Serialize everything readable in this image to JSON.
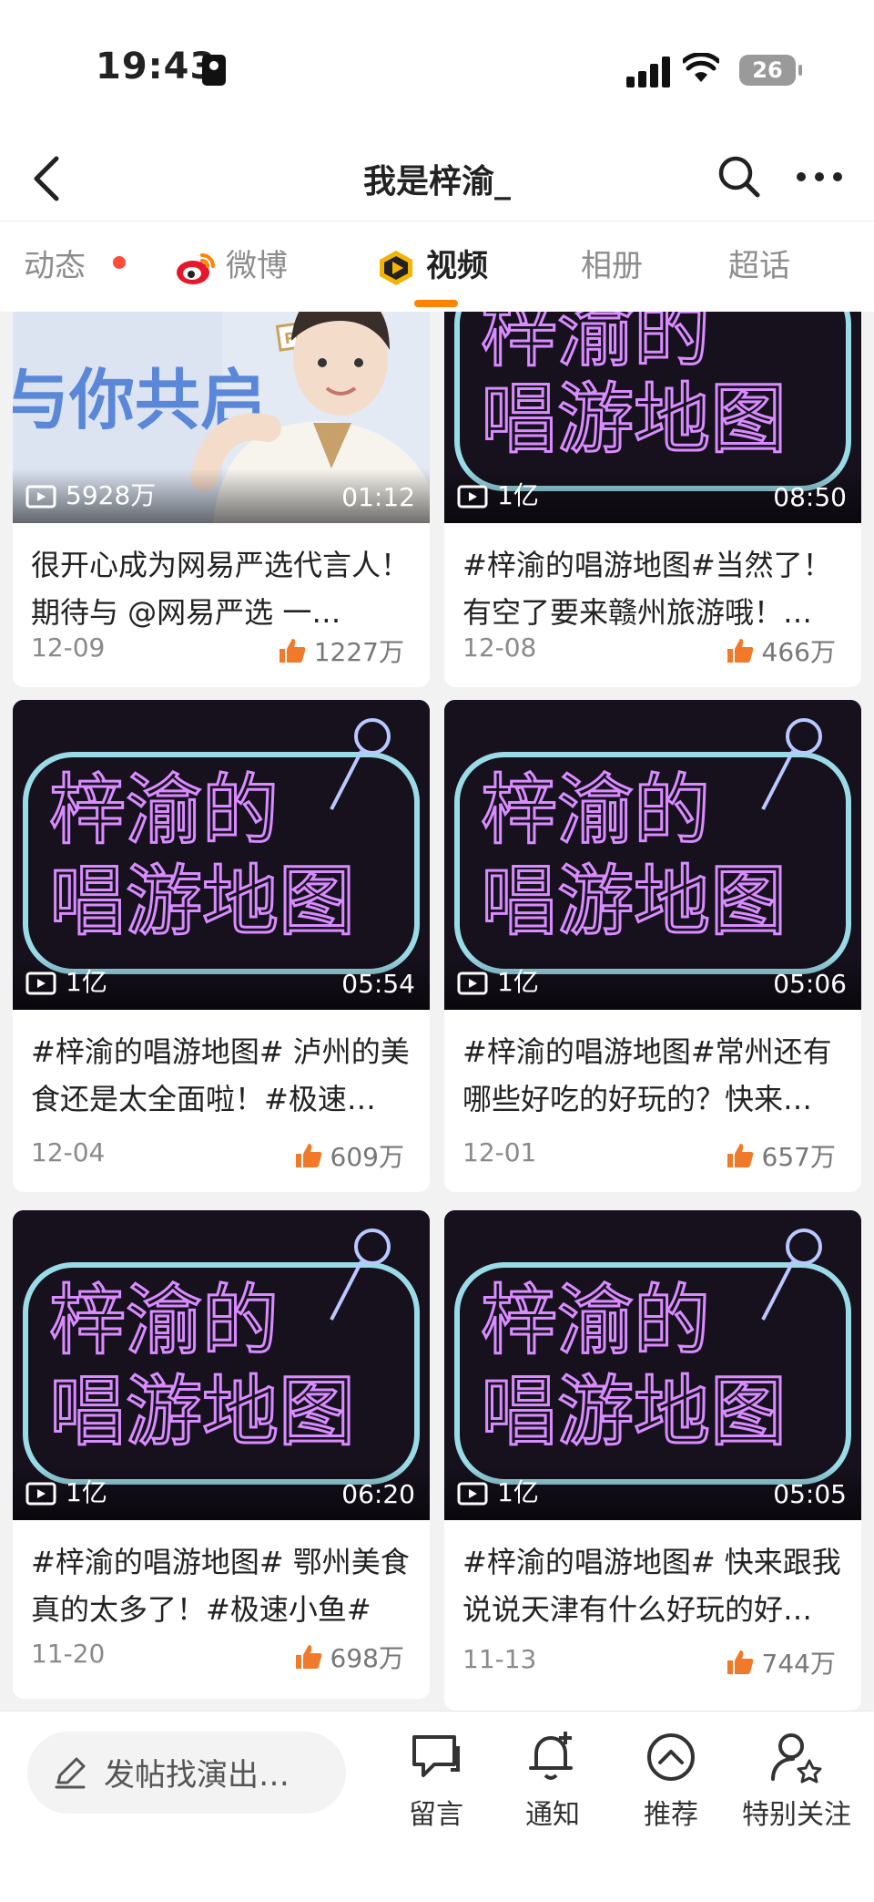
{
  "status": {
    "time": "19:43",
    "battery": "26"
  },
  "nav": {
    "title": "我是梓渝_"
  },
  "tabs": [
    {
      "label": "动态",
      "has_dot": true
    },
    {
      "label": "微博"
    },
    {
      "label": "视频",
      "active": true
    },
    {
      "label": "相册"
    },
    {
      "label": "超话"
    }
  ],
  "videos": [
    {
      "views": "5928万",
      "duration": "01:12",
      "caption": "很开心成为网易严选代言人！期待与 @网易严选 一…",
      "date": "12-09",
      "likes": "1227万",
      "thumb_text": [
        "与你共启",
        "POST"
      ]
    },
    {
      "views": "1亿",
      "duration": "08:50",
      "caption": "#梓渝的唱游地图#当然了！有空了要来赣州旅游哦！…",
      "date": "12-08",
      "likes": "466万",
      "thumb_text": [
        "梓渝的",
        "唱游地图"
      ]
    },
    {
      "views": "1亿",
      "duration": "05:54",
      "caption": "#梓渝的唱游地图# 泸州的美食还是太全面啦！#极速…",
      "date": "12-04",
      "likes": "609万",
      "thumb_text": [
        "梓渝的",
        "唱游地图"
      ]
    },
    {
      "views": "1亿",
      "duration": "05:06",
      "caption": "#梓渝的唱游地图#常州还有哪些好吃的好玩的？快来…",
      "date": "12-01",
      "likes": "657万",
      "thumb_text": [
        "梓渝的",
        "唱游地图"
      ]
    },
    {
      "views": "1亿",
      "duration": "06:20",
      "caption": "#梓渝的唱游地图# 鄂州美食真的太多了！#极速小鱼#",
      "date": "11-20",
      "likes": "698万",
      "thumb_text": [
        "梓渝的",
        "唱游地图"
      ]
    },
    {
      "views": "1亿",
      "duration": "05:05",
      "caption": "#梓渝的唱游地图# 快来跟我说说天津有什么好玩的好…",
      "date": "11-13",
      "likes": "744万",
      "thumb_text": [
        "梓渝的",
        "唱游地图"
      ]
    }
  ],
  "bottom": {
    "compose_placeholder": "发帖找演出…",
    "items": [
      {
        "label": "留言",
        "icon": "comment-icon"
      },
      {
        "label": "通知",
        "icon": "bell-plus-icon"
      },
      {
        "label": "推荐",
        "icon": "chevron-up-circle-icon"
      },
      {
        "label": "特别关注",
        "icon": "user-star-icon"
      }
    ]
  },
  "colors": {
    "accent": "#ff8200",
    "neon_pink": "#d98cff",
    "neon_cyan": "#a8f2ff",
    "like_orange": "#f07a2a"
  }
}
